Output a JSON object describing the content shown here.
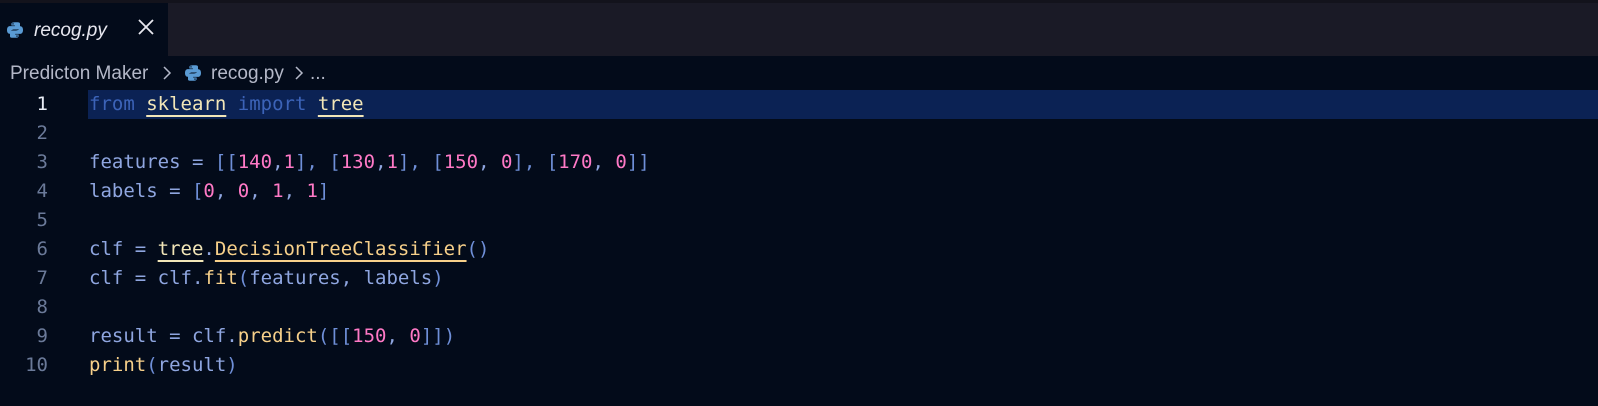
{
  "tab": {
    "label": "recog.py",
    "icon": "python-icon",
    "close_icon": "close-icon"
  },
  "breadcrumb": {
    "root": "Predicton Maker",
    "file": "recog.py",
    "more": "..."
  },
  "editor": {
    "active_line": 1,
    "lines": [
      {
        "n": "1"
      },
      {
        "n": "2"
      },
      {
        "n": "3"
      },
      {
        "n": "4"
      },
      {
        "n": "5"
      },
      {
        "n": "6"
      },
      {
        "n": "7"
      },
      {
        "n": "8"
      },
      {
        "n": "9"
      },
      {
        "n": "10"
      }
    ],
    "tokens": {
      "l1": [
        "from",
        "sklearn",
        "import",
        "tree"
      ],
      "l3": [
        "features",
        " = ",
        "[[",
        "140",
        ",",
        "1",
        "], [",
        "130",
        ",",
        "1",
        "], [",
        "150",
        ", ",
        "0",
        "], [",
        "170",
        ", ",
        "0",
        "]]"
      ],
      "l4": [
        "labels",
        " = ",
        "[",
        "0",
        ", ",
        "0",
        ", ",
        "1",
        ", ",
        "1",
        "]"
      ],
      "l6": [
        "clf",
        " = ",
        "tree",
        ".",
        "DecisionTreeClassifier",
        "()"
      ],
      "l7": [
        "clf",
        " = ",
        "clf",
        ".",
        "fit",
        "(",
        "features, labels",
        ")"
      ],
      "l9": [
        "result",
        " = ",
        "clf",
        ".",
        "predict",
        "([[",
        "150",
        ", ",
        "0",
        "]])"
      ],
      "l10": [
        "print",
        "(",
        "result",
        ")"
      ]
    }
  },
  "colors": {
    "background": "#030b1a",
    "tabbar": "#1a1a26",
    "active_line": "#0b2254",
    "keyword": "#3c63b8",
    "identifier": "#8fa6e0",
    "number": "#ff79c6",
    "function": "#f7d08a",
    "module": "#f2e6b8"
  }
}
